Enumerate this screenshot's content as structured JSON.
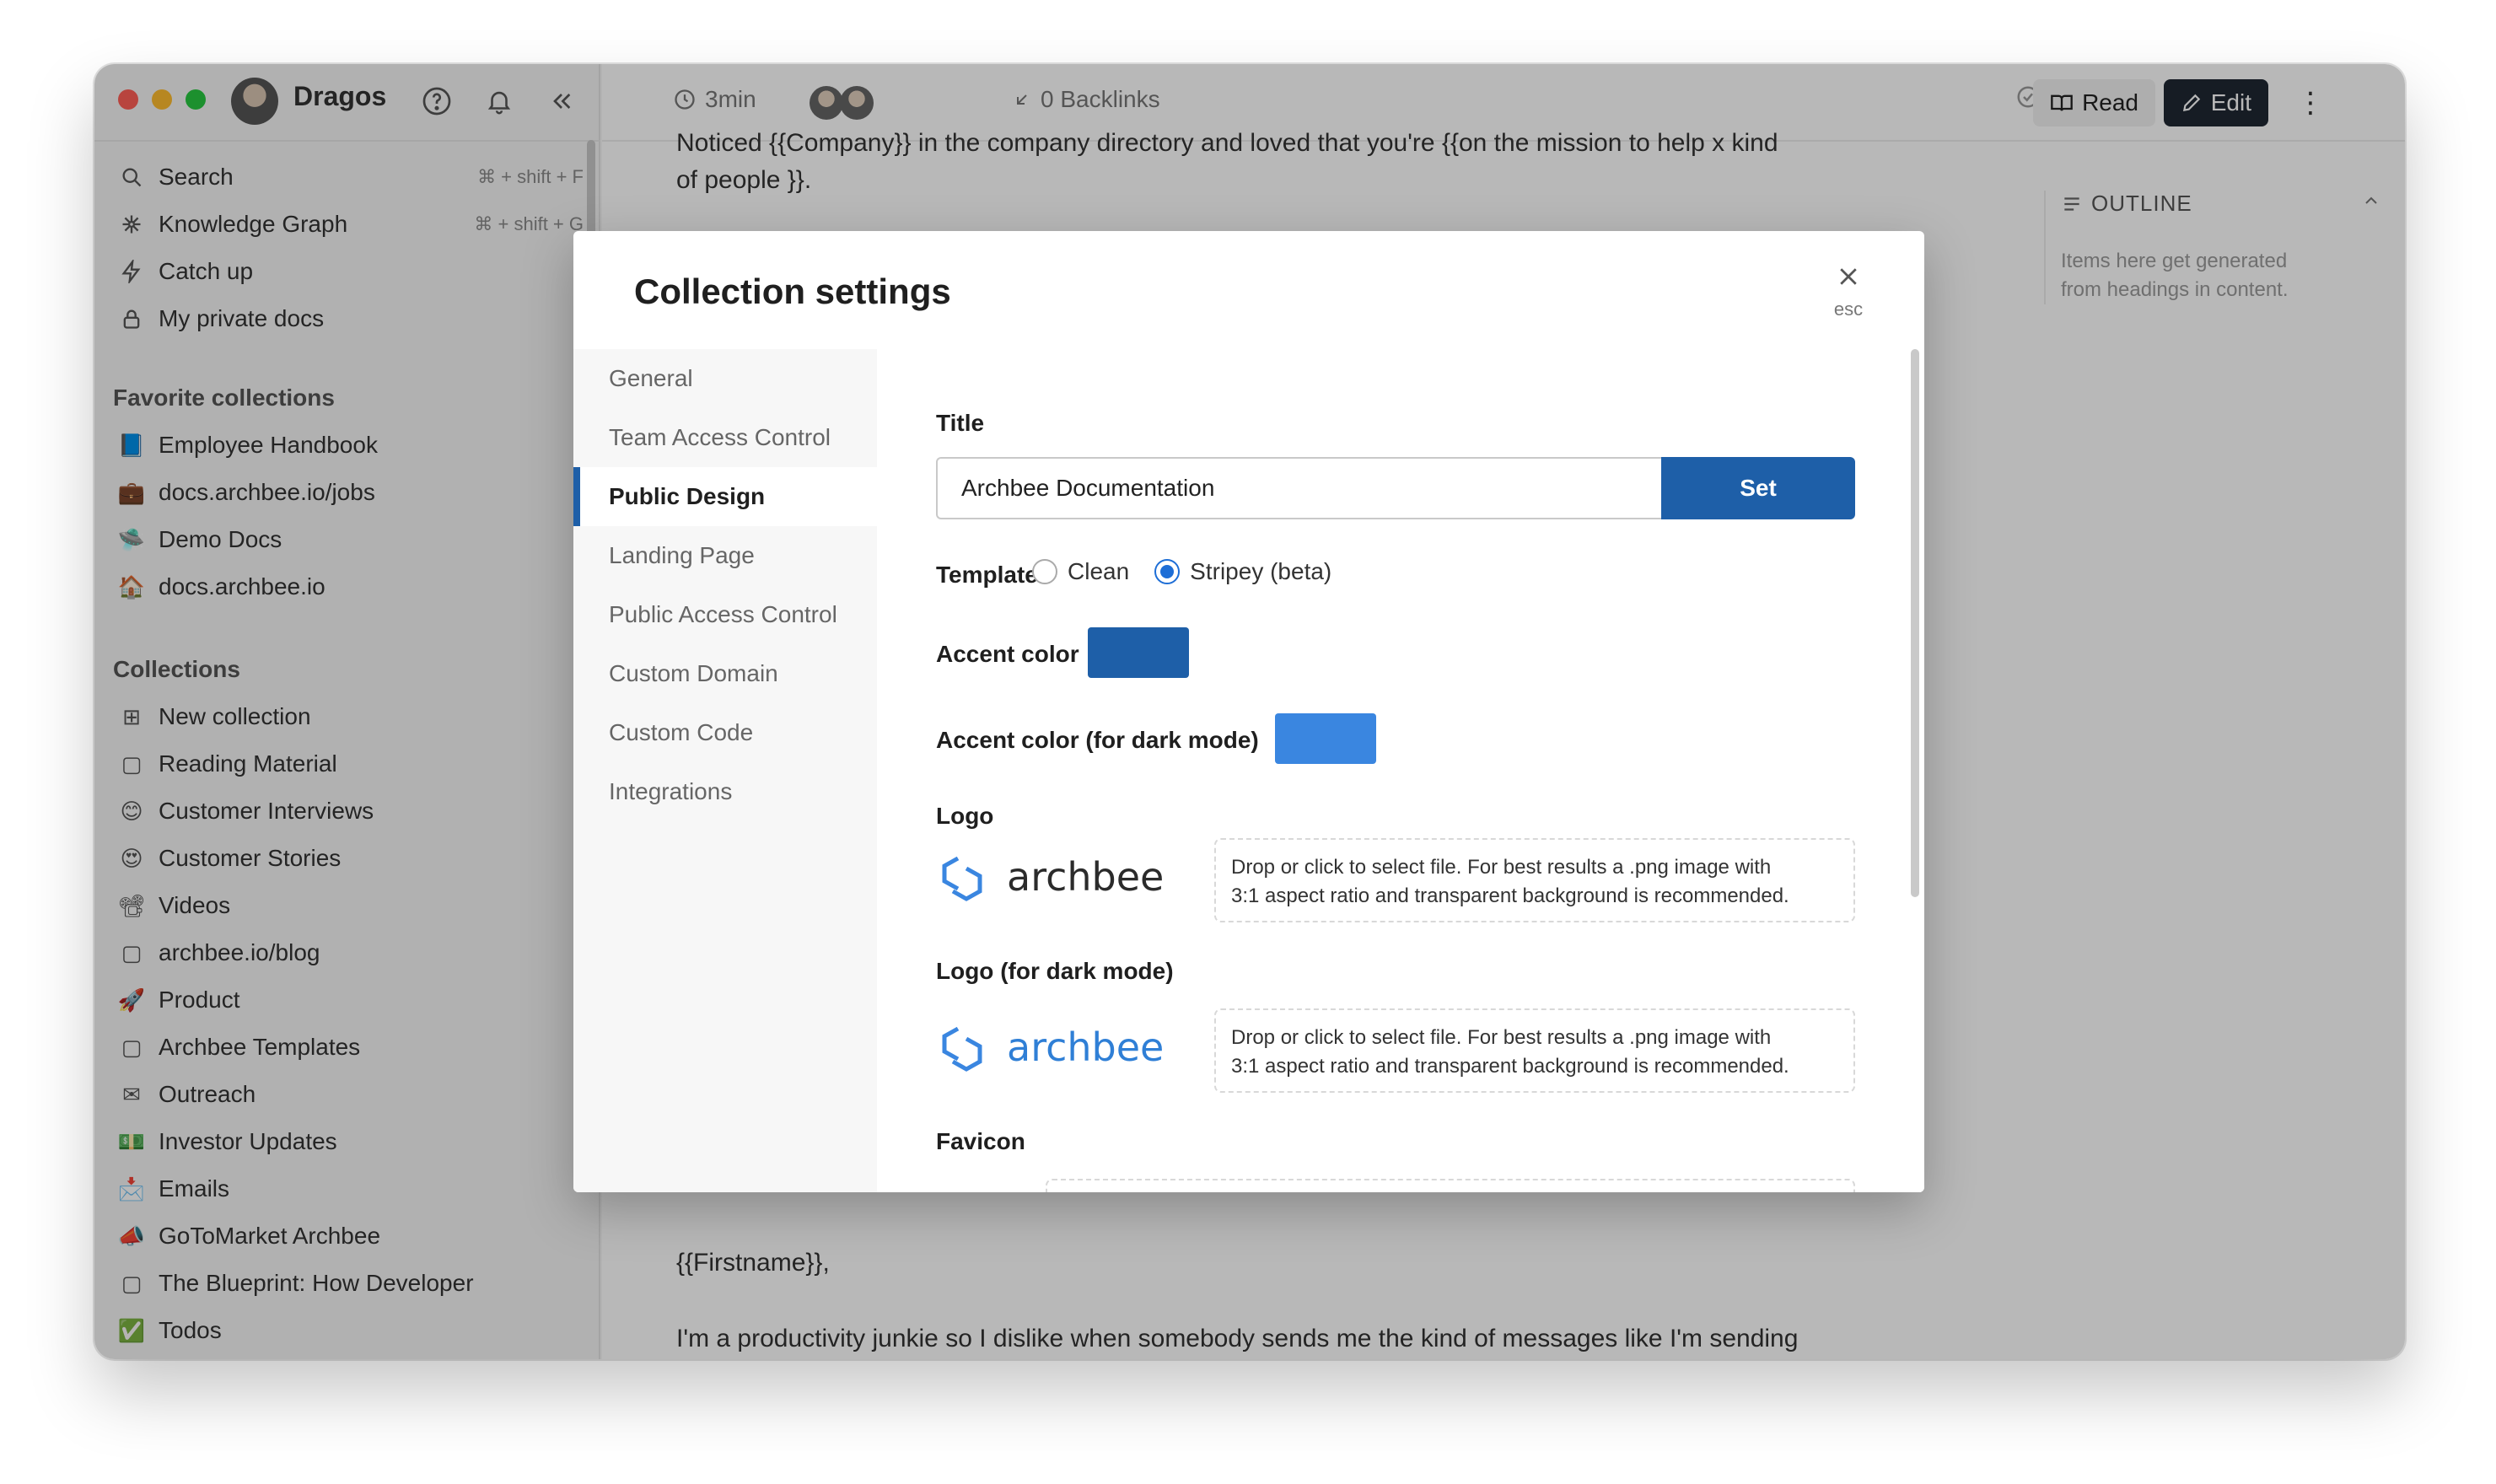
{
  "sidebar": {
    "user_name": "Dragos",
    "top_items": [
      {
        "label": "Search",
        "shortcut": "⌘ + shift + F",
        "icon": "search-icon"
      },
      {
        "label": "Knowledge Graph",
        "shortcut": "⌘ + shift + G",
        "icon": "graph-icon"
      },
      {
        "label": "Catch up",
        "icon": "lightning-icon"
      },
      {
        "label": "My private docs",
        "icon": "lock-icon"
      }
    ],
    "favorites_heading": "Favorite collections",
    "favorites": [
      {
        "label": "Employee Handbook",
        "icon": "📘"
      },
      {
        "label": "docs.archbee.io/jobs",
        "icon": "💼"
      },
      {
        "label": "Demo Docs",
        "icon": "🛸"
      },
      {
        "label": "docs.archbee.io",
        "icon": "🏠"
      }
    ],
    "collections_heading": "Collections",
    "collections": [
      {
        "label": "New collection",
        "icon": "⊞"
      },
      {
        "label": "Reading Material",
        "icon": "▢"
      },
      {
        "label": "Customer Interviews",
        "icon": "😊"
      },
      {
        "label": "Customer Stories",
        "icon": "😍"
      },
      {
        "label": "Videos",
        "icon": "📽"
      },
      {
        "label": "archbee.io/blog",
        "icon": "▢"
      },
      {
        "label": "Product",
        "icon": "🚀"
      },
      {
        "label": "Archbee Templates",
        "icon": "▢"
      },
      {
        "label": "Outreach",
        "icon": "✉"
      },
      {
        "label": "Investor Updates",
        "icon": "💵"
      },
      {
        "label": "Emails",
        "icon": "📩"
      },
      {
        "label": "GoToMarket Archbee",
        "icon": "📣"
      },
      {
        "label": "The Blueprint: How Developer",
        "icon": "▢"
      },
      {
        "label": "Todos",
        "icon": "✅"
      }
    ]
  },
  "header": {
    "read_time": "3min",
    "backlinks": "0 Backlinks",
    "read_label": "Read",
    "edit_label": "Edit"
  },
  "document": {
    "line1": "Noticed {{Company}} in the company directory and loved that you're {{on the mission to help x kind",
    "line2": "of people }}.",
    "line3": "{{Firstname}},",
    "line4": "I'm a productivity junkie so I dislike when somebody sends me the kind of messages like I'm sending"
  },
  "outline": {
    "title": "OUTLINE",
    "hint_line1": "Items here get generated",
    "hint_line2": "from headings in content."
  },
  "modal": {
    "title": "Collection settings",
    "close_hint": "esc",
    "nav": [
      "General",
      "Team Access Control",
      "Public Design",
      "Landing Page",
      "Public Access Control",
      "Custom Domain",
      "Custom Code",
      "Integrations"
    ],
    "active_nav": "Public Design",
    "title_label": "Title",
    "title_value": "Archbee Documentation",
    "set_label": "Set",
    "template_label": "Template",
    "template_options": [
      "Clean",
      "Stripey (beta)"
    ],
    "template_selected": "Stripey (beta)",
    "accent_label": "Accent color",
    "accent_color": "#1e5fa8",
    "accent_dark_label": "Accent color (for dark mode)",
    "accent_dark_color": "#3a86e0",
    "logo_label": "Logo",
    "logo_text": "archbee",
    "logo_dark_label": "Logo (for dark mode)",
    "drop_line1": "Drop or click to select file. For best results a .png image with",
    "drop_line2": "3:1 aspect ratio and transparent background is recommended.",
    "favicon_label": "Favicon"
  }
}
